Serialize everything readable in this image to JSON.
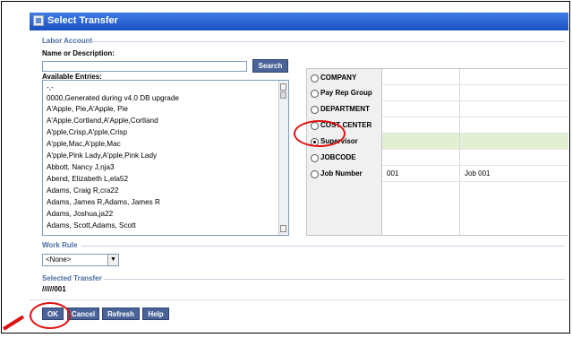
{
  "window": {
    "title": "Select Transfer"
  },
  "labor_account": {
    "section_label": "Labor Account",
    "name_label": "Name or Description:",
    "search_value": "",
    "search_button": "Search",
    "available_label": "Available Entries:",
    "entries": [
      "-,-",
      "0000,Generated during v4.0 DB upgrade",
      "A'Apple, Pie,A'Apple, Pie",
      "A'Apple,Cortland,A'Apple,Cortland",
      "A'pple,Crisp,A'pple,Crisp",
      "A'pple,Mac,A'pple,Mac",
      "A'pple,Pink Lady,A'pple,Pink Lady",
      "Abbott, Nancy J,nja3",
      "Abend, Elizabeth L,ela52",
      "Adams, Craig R,cra22",
      "Adams, James R,Adams, James R",
      "Adams, Joshua,ja22",
      "Adams, Scott,Adams, Scott"
    ]
  },
  "levels": [
    {
      "label": "COMPANY",
      "selected": false,
      "code": "",
      "desc": ""
    },
    {
      "label": "Pay Rep Group",
      "selected": false,
      "code": "",
      "desc": ""
    },
    {
      "label": "DEPARTMENT",
      "selected": false,
      "code": "",
      "desc": ""
    },
    {
      "label": "COST CENTER",
      "selected": false,
      "code": "",
      "desc": ""
    },
    {
      "label": "Supervisor",
      "selected": true,
      "code": "",
      "desc": ""
    },
    {
      "label": "JOBCODE",
      "selected": false,
      "code": "",
      "desc": ""
    },
    {
      "label": "Job Number",
      "selected": false,
      "code": "001",
      "desc": "Job 001"
    }
  ],
  "work_rule": {
    "section_label": "Work Rule",
    "selected": "<None>"
  },
  "selected_transfer": {
    "section_label": "Selected Transfer",
    "value": "//////001"
  },
  "buttons": {
    "ok": "OK",
    "cancel": "Cancel",
    "refresh": "Refresh",
    "help": "Help"
  },
  "colors": {
    "annotation": "#e01010",
    "button": "#4a6499",
    "highlight_row": "#e3efd2"
  }
}
